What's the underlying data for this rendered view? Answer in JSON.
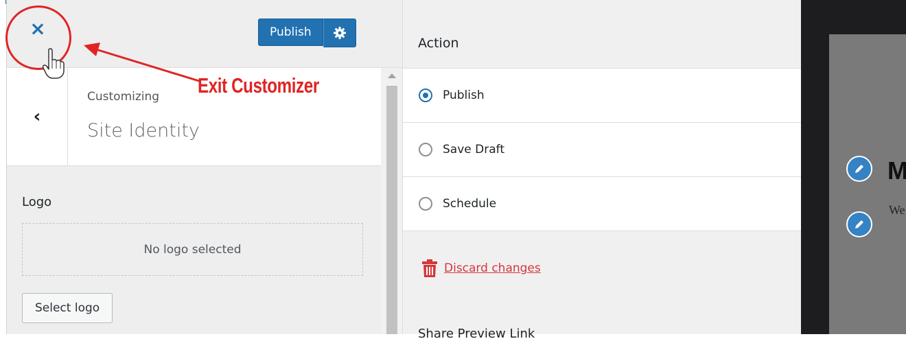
{
  "header": {
    "close_glyph": "×",
    "publish_label": "Publish",
    "gear_icon": "gear-icon"
  },
  "section": {
    "back_glyph": "‹",
    "customizing_label": "Customizing",
    "title": "Site Identity"
  },
  "logo": {
    "label": "Logo",
    "empty_text": "No logo selected",
    "select_label": "Select logo"
  },
  "annotation": {
    "text": "Exit Customizer",
    "color": "#e02424"
  },
  "publish_settings": {
    "heading": "Action",
    "options": [
      {
        "label": "Publish",
        "checked": true
      },
      {
        "label": "Save Draft",
        "checked": false
      },
      {
        "label": "Schedule",
        "checked": false
      }
    ],
    "discard_label": "Discard changes",
    "next_heading_partial": "Share Preview Link"
  },
  "preview": {
    "site_title_partial": "M",
    "tagline_partial": "We"
  },
  "colors": {
    "accent": "#2271b1",
    "danger": "#d63638"
  }
}
